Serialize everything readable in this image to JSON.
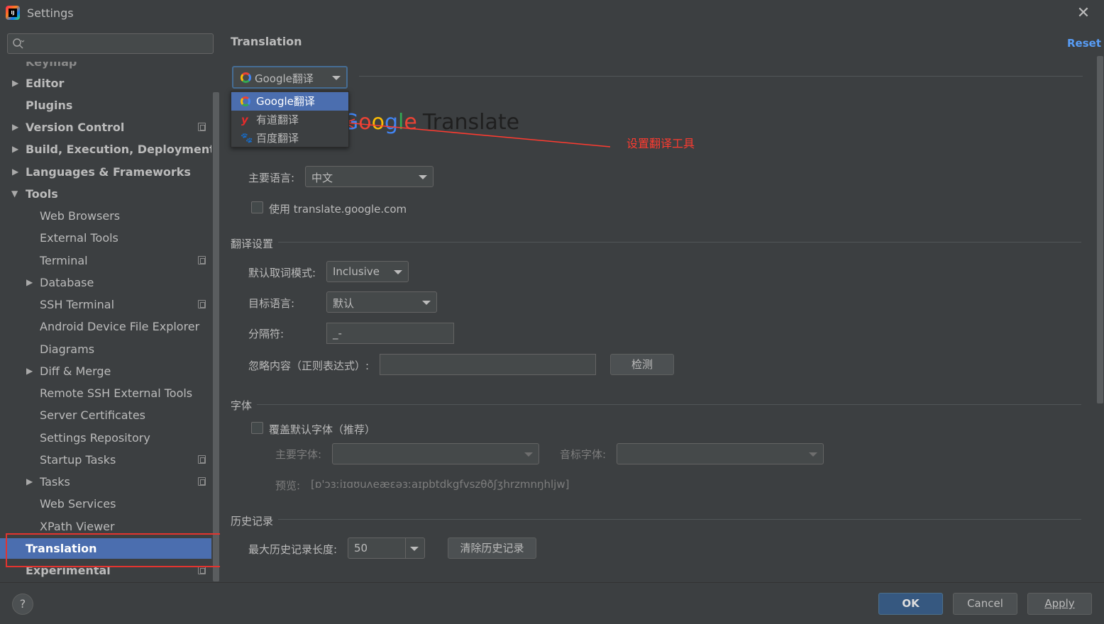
{
  "window": {
    "title": "Settings",
    "close_glyph": "✕"
  },
  "search": {
    "placeholder": ""
  },
  "sidebar": {
    "items": [
      {
        "label": "Keymap"
      },
      {
        "label": "Editor"
      },
      {
        "label": "Plugins"
      },
      {
        "label": "Version Control"
      },
      {
        "label": "Build, Execution, Deployment"
      },
      {
        "label": "Languages & Frameworks"
      },
      {
        "label": "Tools"
      },
      {
        "label": "Web Browsers"
      },
      {
        "label": "External Tools"
      },
      {
        "label": "Terminal"
      },
      {
        "label": "Database"
      },
      {
        "label": "SSH Terminal"
      },
      {
        "label": "Android Device File Explorer"
      },
      {
        "label": "Diagrams"
      },
      {
        "label": "Diff & Merge"
      },
      {
        "label": "Remote SSH External Tools"
      },
      {
        "label": "Server Certificates"
      },
      {
        "label": "Settings Repository"
      },
      {
        "label": "Startup Tasks"
      },
      {
        "label": "Tasks"
      },
      {
        "label": "Web Services"
      },
      {
        "label": "XPath Viewer"
      },
      {
        "label": "Translation"
      },
      {
        "label": "Experimental"
      }
    ]
  },
  "page": {
    "title": "Translation",
    "reset_label": "Reset"
  },
  "engine": {
    "selected": "Google翻译",
    "options": [
      {
        "label": "Google翻译"
      },
      {
        "label": "有道翻译"
      },
      {
        "label": "百度翻译"
      }
    ],
    "logo": {
      "g1": "G",
      "g2": "o",
      "g3": "o",
      "g4": "g",
      "g5": "l",
      "g6": "e",
      "suffix": "Translate"
    }
  },
  "annotation": {
    "text": "设置翻译工具"
  },
  "google_settings": {
    "primary_language_label": "主要语言:",
    "primary_language_value": "中文",
    "use_domain_label": "使用 translate.google.com"
  },
  "translation_settings": {
    "section_label": "翻译设置",
    "word_mode_label": "默认取词模式:",
    "word_mode_value": "Inclusive",
    "target_language_label": "目标语言:",
    "target_language_value": "默认",
    "separator_label": "分隔符:",
    "separator_value": "_-",
    "ignore_label": "忽略内容（正则表达式）:",
    "ignore_value": "",
    "check_button": "检测"
  },
  "font_settings": {
    "section_label": "字体",
    "override_label": "覆盖默认字体（推荐）",
    "primary_font_label": "主要字体:",
    "phonetic_font_label": "音标字体:",
    "preview_label": "预览:",
    "preview_text": "[ɒ'ɔɜːiɪɑʊuʌeæɛəɜːaɪpbtdkgfvszθðʃʒhrzmnŋhljw]"
  },
  "history": {
    "section_label": "历史记录",
    "max_length_label": "最大历史记录长度:",
    "max_length_value": "50",
    "clear_button": "清除历史记录"
  },
  "footer": {
    "help": "?",
    "ok": "OK",
    "cancel": "Cancel",
    "apply": "Apply"
  },
  "colors": {
    "background": "#3c3f41",
    "selection": "#4b6eaf",
    "link": "#589df6",
    "annotation": "#ff3b30",
    "primary_button": "#365880"
  }
}
